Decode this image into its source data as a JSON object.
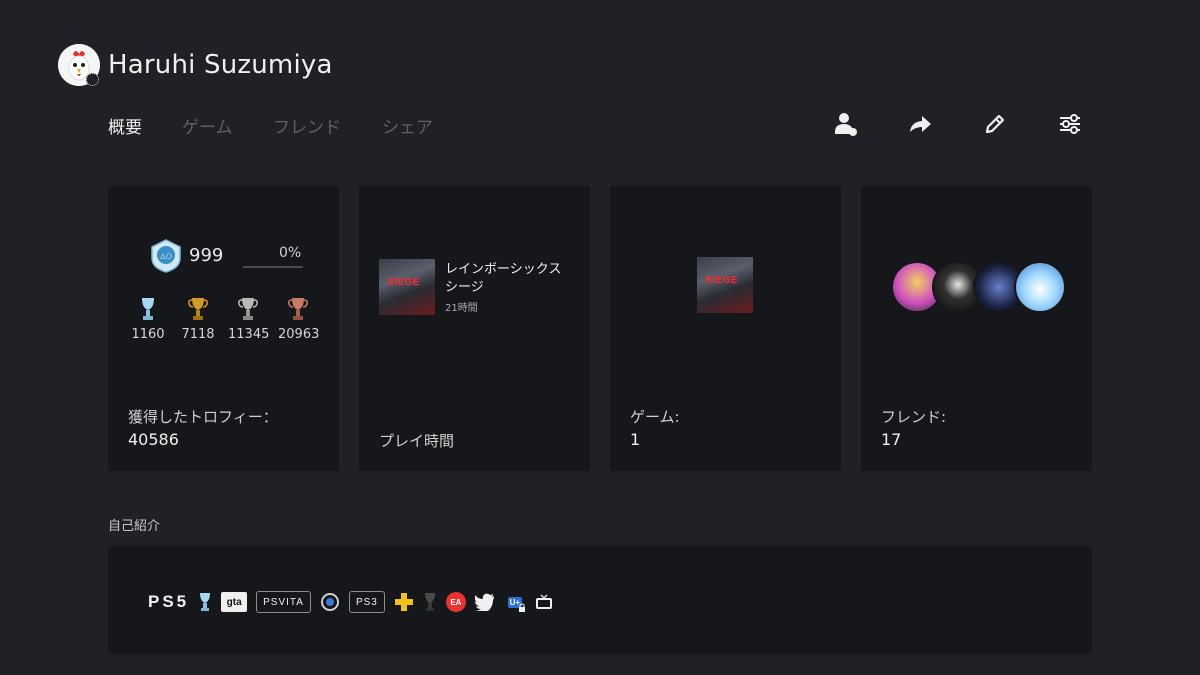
{
  "profile": {
    "username": "Haruhi Suzumiya"
  },
  "tabs": [
    {
      "label": "概要",
      "active": true
    },
    {
      "label": "ゲーム",
      "active": false
    },
    {
      "label": "フレンド",
      "active": false
    },
    {
      "label": "シェア",
      "active": false
    }
  ],
  "toolbar": {
    "icons": [
      "friend-request-icon",
      "share-icon",
      "edit-icon",
      "settings-icon"
    ]
  },
  "trophy_card": {
    "level": "999",
    "progress_text": "0%",
    "progress_fraction": 0.0,
    "trophies": [
      {
        "type": "platinum",
        "count": "1160"
      },
      {
        "type": "gold",
        "count": "7118"
      },
      {
        "type": "silver",
        "count": "11345"
      },
      {
        "type": "bronze",
        "count": "20963"
      }
    ],
    "label": "獲得したトロフィー：",
    "total": "40586"
  },
  "playtime_card": {
    "game_title": "レインボーシックス シージ",
    "game_hours": "21時間",
    "label": "プレイ時間"
  },
  "games_card": {
    "label": "ゲーム:",
    "value": "1"
  },
  "friends_card": {
    "label": "フレンド:",
    "value": "17"
  },
  "about": {
    "heading": "自己紹介",
    "badges": [
      "PS5",
      "platinum-trophy-icon",
      "gta",
      "PSVITA",
      "playstation-icon",
      "PS3",
      "ps-plus-icon",
      "trophy-icon",
      "EA",
      "twitter-icon",
      "U+",
      "tv-icon"
    ],
    "badge_ps5": "PS5",
    "badge_gta": "gta",
    "badge_psvita": "PSVITA",
    "badge_ps3": "PS3",
    "badge_ea": "EA",
    "badge_u": "U+"
  },
  "colors": {
    "background": "#202126",
    "card": "#16171b",
    "platinum": "#9fd2f0",
    "gold": "#d39a2a",
    "silver": "#b9b9b9",
    "bronze": "#c77b62",
    "ps_plus": "#f3c21a",
    "ea": "#e8332f"
  }
}
